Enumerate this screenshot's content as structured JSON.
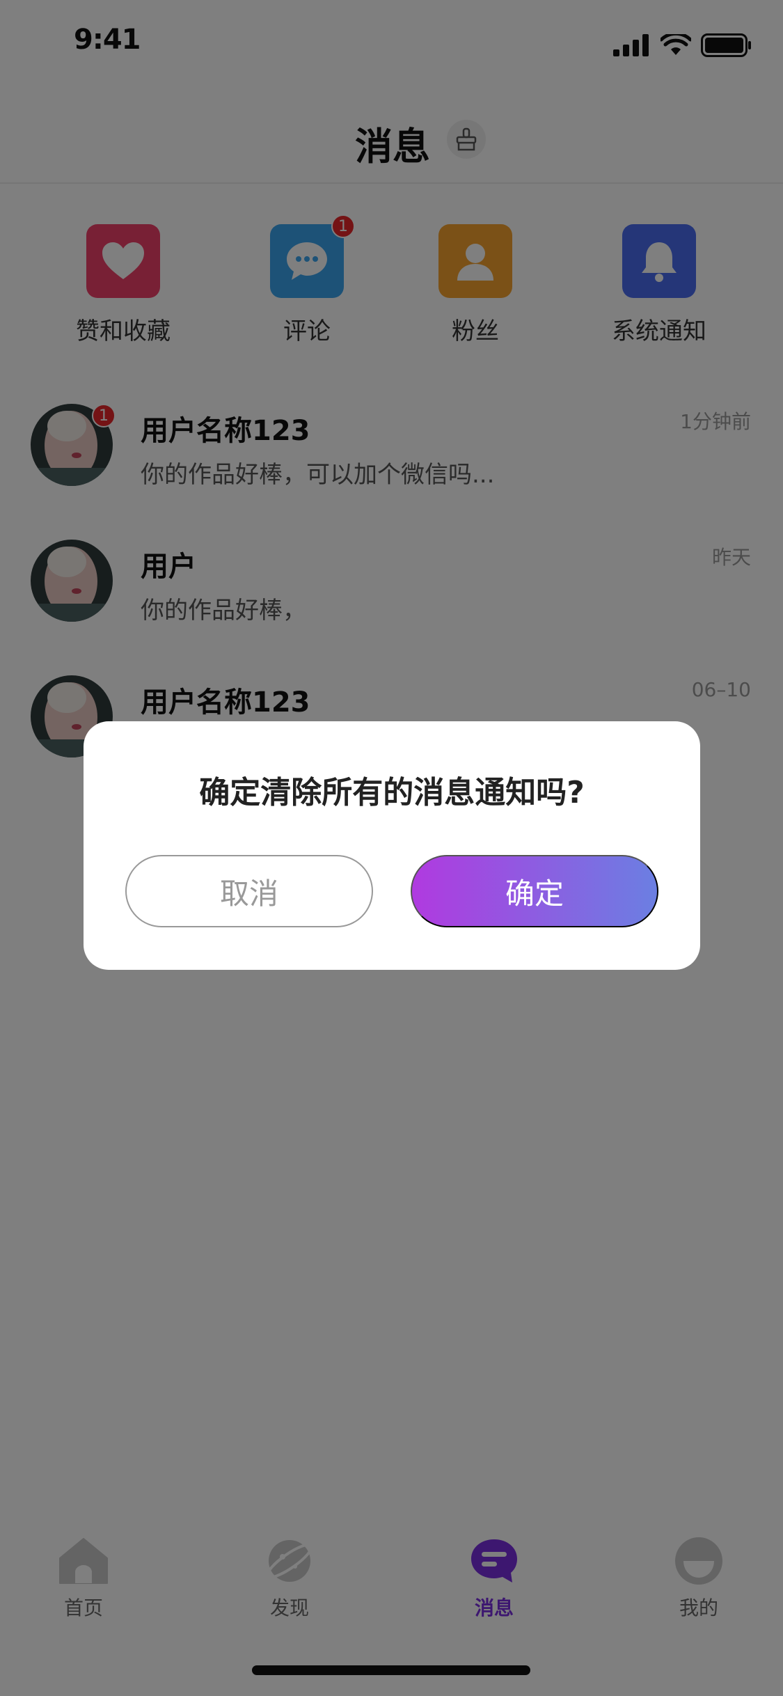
{
  "status_bar": {
    "time": "9:41"
  },
  "header": {
    "title": "消息"
  },
  "categories": [
    {
      "label": "赞和收藏",
      "icon": "heart-icon",
      "color": "#f0416a"
    },
    {
      "label": "评论",
      "icon": "chat-bubble-icon",
      "color": "#3aa4ee",
      "badge": "1"
    },
    {
      "label": "粉丝",
      "icon": "user-icon",
      "color": "#f7a32e"
    },
    {
      "label": "系统通知",
      "icon": "bell-icon",
      "color": "#4a6cf0"
    }
  ],
  "messages": [
    {
      "name": "用户名称123",
      "preview": "你的作品好棒，可以加个微信吗...",
      "time": "1分钟前",
      "badge": "1"
    },
    {
      "name": "用户",
      "preview": "你的作品好棒，",
      "time": "昨天"
    },
    {
      "name": "用户名称123",
      "preview": "",
      "time": "06–10"
    }
  ],
  "dialog": {
    "message": "确定清除所有的消息通知吗?",
    "cancel_label": "取消",
    "confirm_label": "确定"
  },
  "tab_bar": {
    "tabs": [
      {
        "label": "首页",
        "icon": "home-icon"
      },
      {
        "label": "发现",
        "icon": "planet-icon"
      },
      {
        "label": "消息",
        "icon": "message-icon",
        "active": true
      },
      {
        "label": "我的",
        "icon": "profile-icon"
      }
    ]
  },
  "colors": {
    "accent": "#7b2fe0",
    "badge": "#e8262b",
    "confirm_gradient_start": "#b03ae0",
    "confirm_gradient_end": "#6b7fe2"
  }
}
